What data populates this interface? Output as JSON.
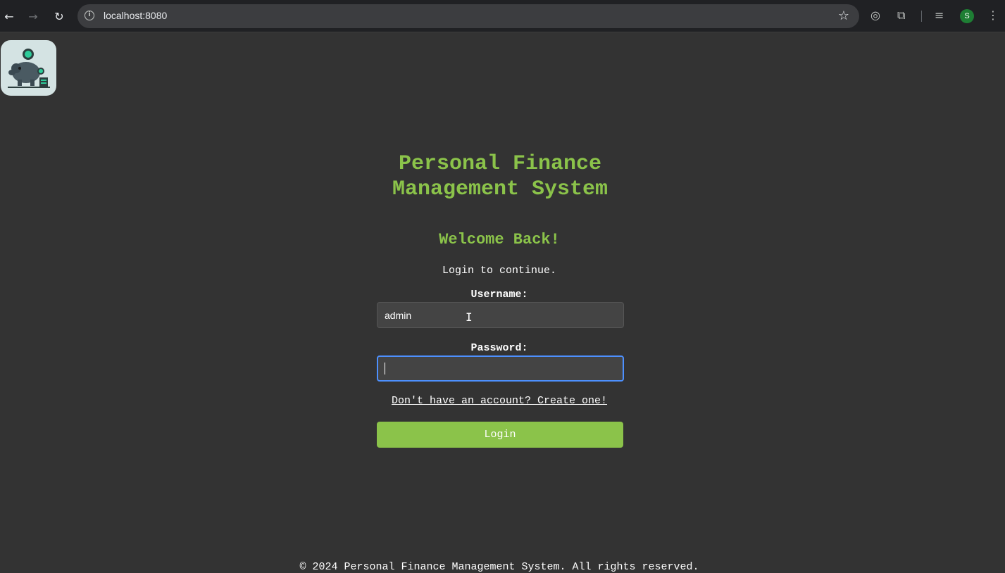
{
  "browser": {
    "back_icon": "arrow-left-icon",
    "forward_icon": "arrow-right-icon",
    "reload_icon": "reload-icon",
    "url": "localhost:8080",
    "bookmark_icon": "star-icon",
    "profile_initial": "S"
  },
  "app": {
    "logo_icon": "piggy-bank-icon",
    "title": "Personal Finance Management System",
    "welcome": "Welcome Back!",
    "subtitle": "Login to continue.",
    "username_label": "Username:",
    "username_value": "admin",
    "password_label": "Password:",
    "password_value": "",
    "signup_link": "Don't have an account? Create one!",
    "login_button": "Login",
    "footer": "© 2024 Personal Finance Management System. All rights reserved."
  },
  "colors": {
    "background": "#333333",
    "accent": "#8bc34a",
    "focus": "#4d90fe"
  }
}
